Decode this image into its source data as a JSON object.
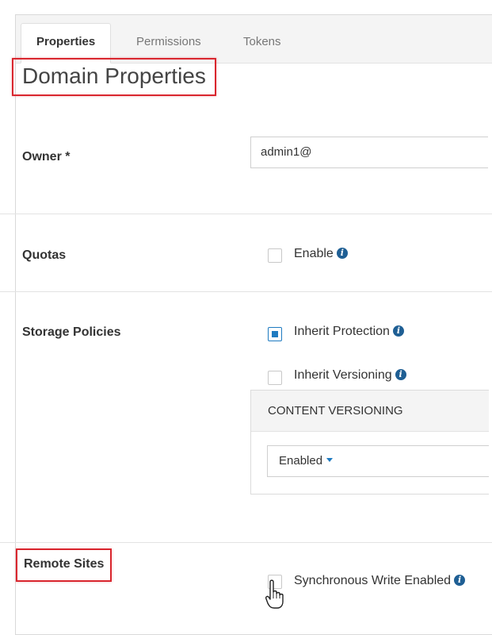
{
  "tabs": [
    {
      "label": "Properties",
      "active": true
    },
    {
      "label": "Permissions",
      "active": false
    },
    {
      "label": "Tokens",
      "active": false
    }
  ],
  "page_title": "Domain Properties",
  "owner": {
    "label": "Owner *",
    "value": "admin1@"
  },
  "quotas": {
    "label": "Quotas",
    "enable_label": "Enable",
    "enabled": false
  },
  "storage_policies": {
    "label": "Storage Policies",
    "inherit_protection_label": "Inherit Protection",
    "inherit_protection_checked": true,
    "inherit_versioning_label": "Inherit Versioning",
    "inherit_versioning_checked": false,
    "content_versioning": {
      "header": "CONTENT VERSIONING",
      "selected": "Enabled"
    }
  },
  "remote_sites": {
    "label": "Remote Sites",
    "sync_write_label": "Synchronous Write Enabled",
    "sync_write_checked": false
  },
  "colors": {
    "accent": "#1f7bc1",
    "highlight": "#d9262e",
    "info_icon": "#1f5f94"
  },
  "icons": {
    "info": "info-icon",
    "caret": "caret-down-icon",
    "cursor": "hand-pointer-cursor"
  }
}
